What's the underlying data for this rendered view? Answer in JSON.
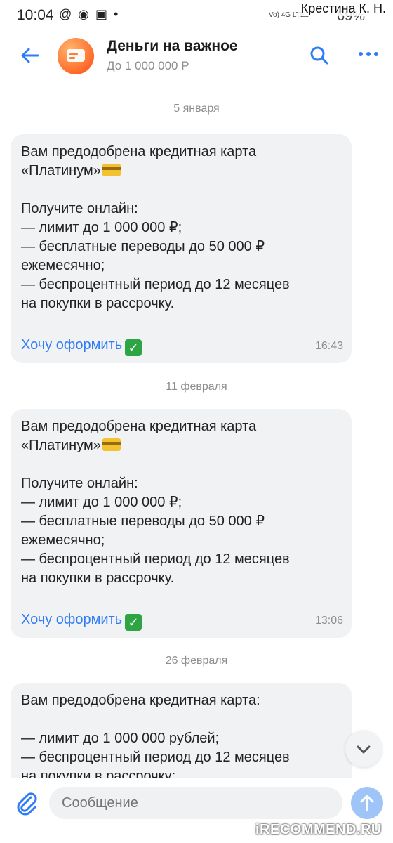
{
  "status_bar": {
    "time": "10:04",
    "icons": "@ ◉ ▣ •",
    "network": "Vo) 4G LTE1",
    "battery": "69%"
  },
  "watermark_top": "Крестина К. Н.",
  "header": {
    "title": "Деньги на важное",
    "subtitle": "До 1 000 000 Р"
  },
  "messages": [
    {
      "date": "5 января",
      "line1": "Вам предодобрена кредитная карта",
      "line2": "«Платинум»",
      "body": "Получите онлайн:\n— лимит до 1 000 000 ₽;\n— бесплатные переводы до 50 000 ₽\nежемесячно;\n— беспроцентный период до 12 месяцев\nна покупки в рассрочку.",
      "link": "Хочу оформить",
      "time": "16:43"
    },
    {
      "date": "11 февраля",
      "line1": "Вам предодобрена кредитная карта",
      "line2": "«Платинум»",
      "body": "Получите онлайн:\n— лимит до 1 000 000 ₽;\n— бесплатные переводы до 50 000 ₽\nежемесячно;\n— беспроцентный период до 12 месяцев\nна покупки в рассрочку.",
      "link": "Хочу оформить",
      "time": "13:06"
    },
    {
      "date": "26 февраля",
      "body": "Вам предодобрена кредитная карта:\n\n— лимит до 1 000 000 рублей;\n— беспроцентный период до 12 месяцев\nна покупки в рассрочку;"
    }
  ],
  "composer": {
    "placeholder": "Сообщение"
  },
  "watermark_bottom": "iRECOMMEND.RU",
  "colors": {
    "accent": "#2e7cf6",
    "bubble": "#f1f2f4",
    "send_disabled": "#9ec4f8"
  },
  "icons": {
    "back": "arrow-left-icon",
    "search": "search-icon",
    "more": "more-dots-icon",
    "scroll": "chevron-down-icon",
    "attach": "paperclip-icon",
    "send": "arrow-up-icon"
  }
}
